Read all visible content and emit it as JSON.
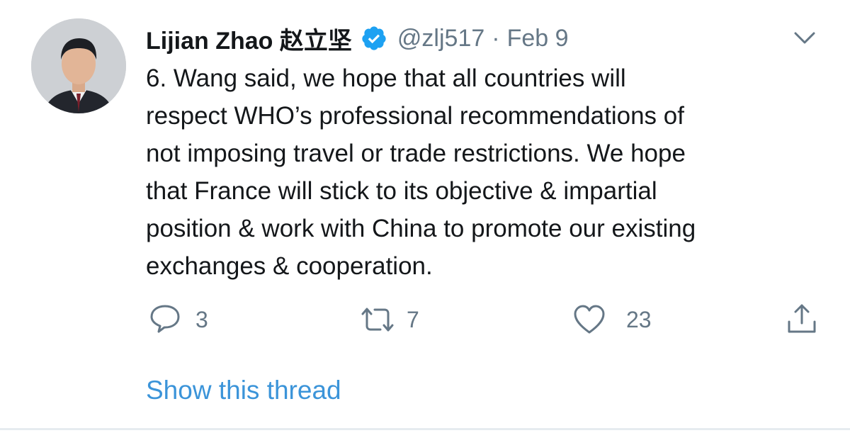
{
  "author": {
    "name": "Lijian Zhao 赵立坚",
    "handle": "@zlj517",
    "separator": "·",
    "date": "Feb 9",
    "verified": true
  },
  "tweet": {
    "text": "6. Wang said, we hope that all countries will\nrespect WHO’s professional recommendations of\nnot imposing travel or trade restrictions. We hope\nthat France will stick to its objective & impartial\nposition & work with China to promote our existing\nexchanges & cooperation."
  },
  "actions": {
    "reply_count": "3",
    "retweet_count": "7",
    "like_count": "23"
  },
  "thread_link_label": "Show this thread",
  "colors": {
    "accent": "#3b94d9",
    "verified": "#1da1f2",
    "muted": "#657786",
    "text": "#14171a"
  },
  "icons": [
    "avatar",
    "verified-badge-icon",
    "chevron-down-icon",
    "reply-icon",
    "retweet-icon",
    "like-icon",
    "share-icon"
  ]
}
